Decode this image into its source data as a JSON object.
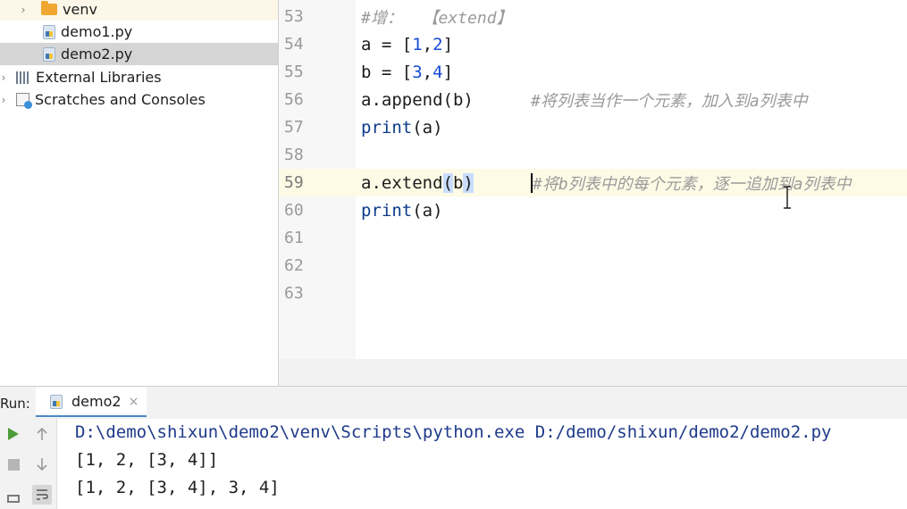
{
  "project_tree": {
    "items": [
      {
        "label": "venv",
        "icon": "folder-icon"
      },
      {
        "label": "demo1.py",
        "icon": "python-file-icon"
      },
      {
        "label": "demo2.py",
        "icon": "python-file-icon",
        "selected": true
      },
      {
        "label": "External Libraries",
        "icon": "library-icon"
      },
      {
        "label": "Scratches and Consoles",
        "icon": "scratches-icon"
      }
    ]
  },
  "editor": {
    "line_numbers": [
      "53",
      "54",
      "55",
      "56",
      "57",
      "58",
      "59",
      "60",
      "61",
      "62",
      "63"
    ],
    "current_line": "59",
    "lines": {
      "l53": {
        "comment": "#增：  【extend】"
      },
      "l54": {
        "a": "a = [",
        "n1": "1",
        "comma": ",",
        "n2": "2",
        "close": "]"
      },
      "l55": {
        "a": "b = [",
        "n1": "3",
        "comma": ",",
        "n2": "4",
        "close": "]"
      },
      "l56": {
        "code": "a.append(b)",
        "comment": "#将列表当作一个元素，加入到a列表中"
      },
      "l57": {
        "fn": "print",
        "args": "(a)"
      },
      "l59": {
        "pre": "a.extend",
        "paren_open": "(",
        "arg": "b",
        "paren_close": ")",
        "comment": "#将b列表中的每个元素，逐一追加到a列表中"
      },
      "l60": {
        "fn": "print",
        "args": "(a)"
      }
    }
  },
  "run": {
    "label": "Run:",
    "tab_label": "demo2",
    "close_glyph": "×",
    "output": [
      "D:\\demo\\shixun\\demo2\\venv\\Scripts\\python.exe D:/demo/shixun/demo2/demo2.py",
      "[1, 2, [3, 4]]",
      "[1, 2, [3, 4], 3, 4]"
    ]
  },
  "colors": {
    "number": "#1a4bd6",
    "comment": "#9a9a9a",
    "current_line_bg": "#fdfbe6",
    "selection_bg": "#d5d5d5",
    "run_icon": "#4d9d3a"
  }
}
